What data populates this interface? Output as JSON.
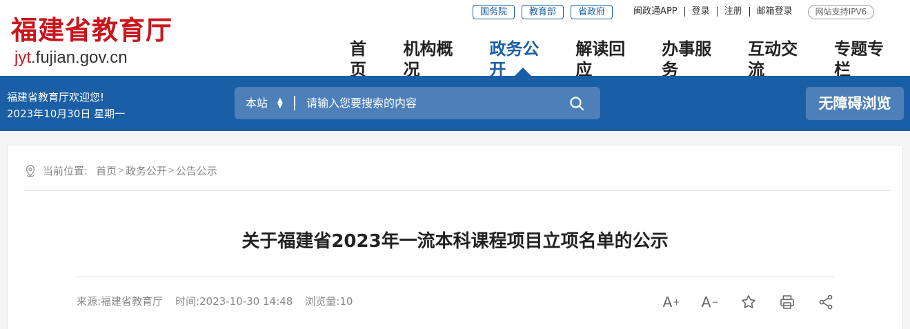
{
  "header": {
    "logo_cn": "福建省教育厅",
    "logo_url_prefix": "jyt",
    "logo_url_rest": ".fujian.gov.cn",
    "top_pills": [
      "国务院",
      "教育部",
      "省政府"
    ],
    "top_links": [
      "闽政通APP",
      "登录",
      "注册",
      "邮箱登录"
    ],
    "ipv6_badge": "网站支持IPV6",
    "nav": [
      "首页",
      "机构概况",
      "政务公开",
      "解读回应",
      "办事服务",
      "互动交流",
      "专题专栏"
    ],
    "active_nav": "政务公开"
  },
  "bar": {
    "welcome": "福建省教育厅欢迎您!",
    "date": "2023年10月30日 星期一",
    "search_scope": "本站",
    "search_placeholder": "请输入您要搜索的内容",
    "accessibility": "无障碍浏览"
  },
  "breadcrumb": {
    "label": "当前位置:",
    "items": [
      "首页",
      "政务公开",
      "公告公示"
    ]
  },
  "article": {
    "title": "关于福建省2023年一流本科课程项目立项名单的公示",
    "source": "来源:福建省教育厅",
    "time": "时间:2023-10-30 14:48",
    "views": "浏览量:10"
  },
  "tools": [
    "font-increase-icon",
    "font-decrease-icon",
    "star-icon",
    "print-icon",
    "share-icon"
  ],
  "colors": {
    "brand_blue": "#1a5ea6",
    "logo_red": "#c8161d"
  }
}
